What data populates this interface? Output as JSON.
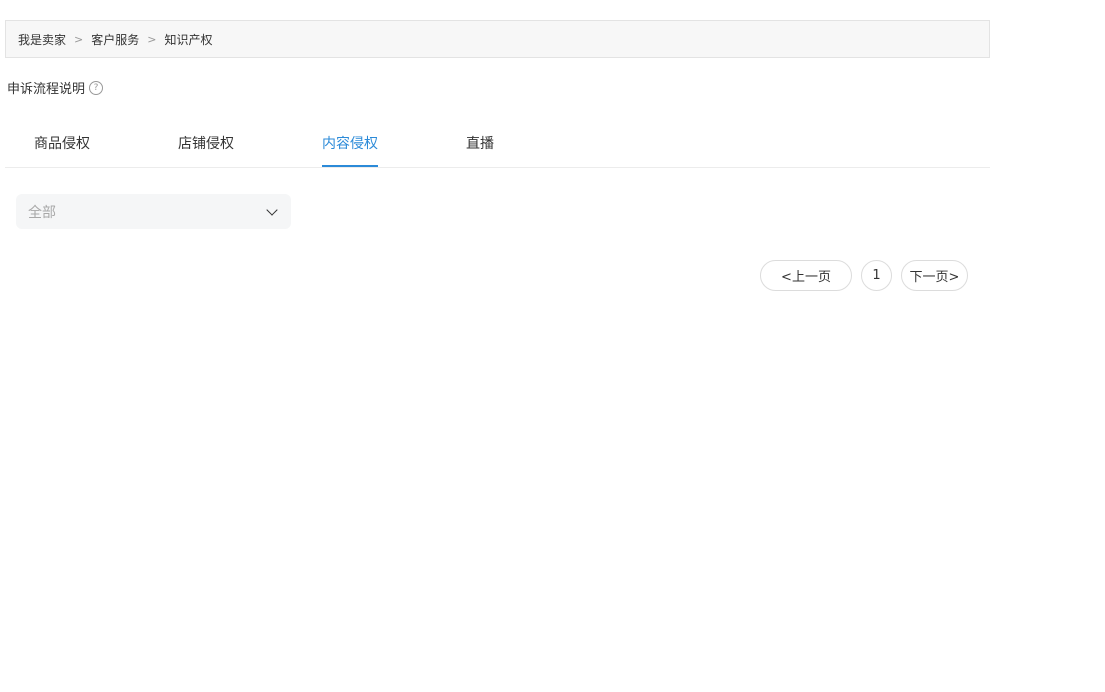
{
  "breadcrumb": {
    "items": [
      "我是卖家",
      "客户服务",
      "知识产权"
    ],
    "separator": ">"
  },
  "help": {
    "label": "申诉流程说明",
    "icon": "question-circle-icon",
    "icon_glyph": "?"
  },
  "tabs": [
    {
      "label": "商品侵权",
      "active": false
    },
    {
      "label": "店铺侵权",
      "active": false
    },
    {
      "label": "内容侵权",
      "active": true
    },
    {
      "label": "直播",
      "active": false
    }
  ],
  "filter": {
    "selected": "全部",
    "icon": "chevron-down-icon"
  },
  "pagination": {
    "prev_label": "<上一页",
    "current_page": "1",
    "next_label": "下一页>"
  },
  "colors": {
    "accent": "#2b8ad8",
    "breadcrumb_bg": "#f7f7f7",
    "select_bg": "#f5f6f7"
  }
}
